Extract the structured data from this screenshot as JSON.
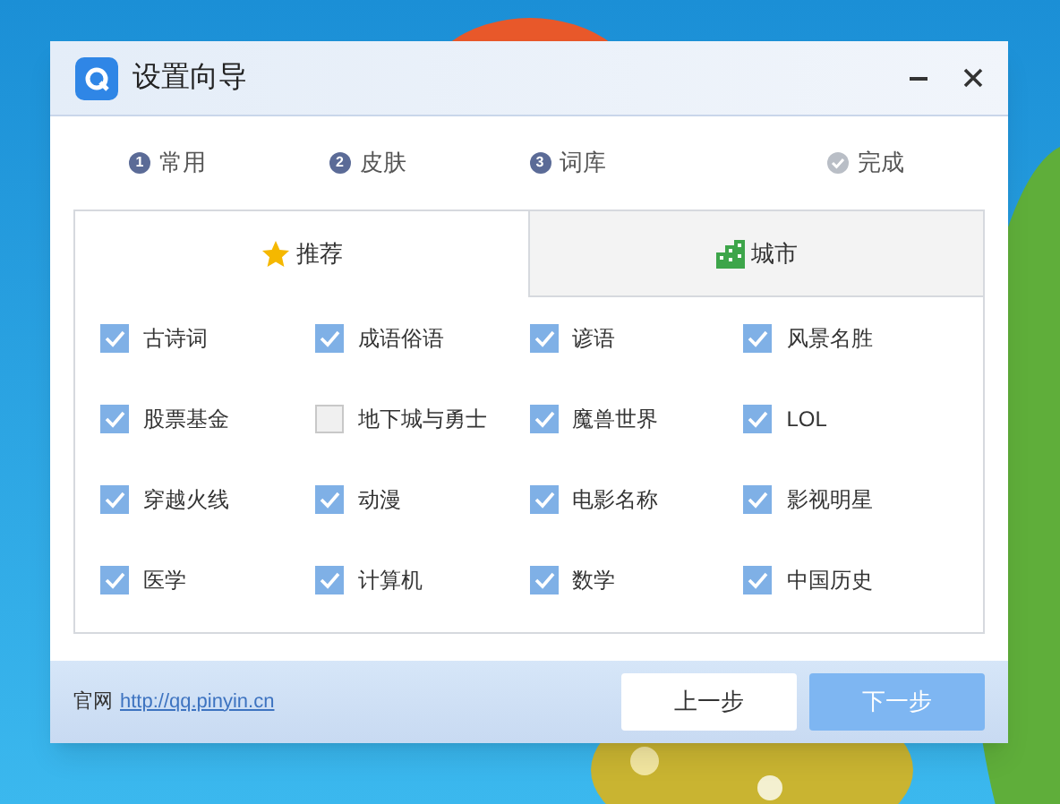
{
  "window": {
    "title": "设置向导"
  },
  "steps": [
    {
      "kind": "numbered",
      "number": "1",
      "label": "常用"
    },
    {
      "kind": "numbered",
      "number": "2",
      "label": "皮肤"
    },
    {
      "kind": "numbered",
      "number": "3",
      "label": "词库"
    },
    {
      "kind": "check",
      "label": "完成"
    }
  ],
  "tabs": [
    {
      "label": "推荐",
      "kind": "star",
      "selected": true
    },
    {
      "label": "城市",
      "kind": "building",
      "selected": false
    }
  ],
  "options": [
    {
      "label": "古诗词",
      "checked": true
    },
    {
      "label": "成语俗语",
      "checked": true
    },
    {
      "label": "谚语",
      "checked": true
    },
    {
      "label": "风景名胜",
      "checked": true
    },
    {
      "label": "股票基金",
      "checked": true
    },
    {
      "label": "地下城与勇士",
      "checked": false
    },
    {
      "label": "魔兽世界",
      "checked": true
    },
    {
      "label": "LOL",
      "checked": true
    },
    {
      "label": "穿越火线",
      "checked": true
    },
    {
      "label": "动漫",
      "checked": true
    },
    {
      "label": "电影名称",
      "checked": true
    },
    {
      "label": "影视明星",
      "checked": true
    },
    {
      "label": "医学",
      "checked": true
    },
    {
      "label": "计算机",
      "checked": true
    },
    {
      "label": "数学",
      "checked": true
    },
    {
      "label": "中国历史",
      "checked": true
    }
  ],
  "footer": {
    "site_label": "官网",
    "site_link": "http://qq.pinyin.cn"
  },
  "buttons": [
    {
      "label": "上一步",
      "kind": "secondary"
    },
    {
      "label": "下一步",
      "kind": "primary"
    }
  ]
}
